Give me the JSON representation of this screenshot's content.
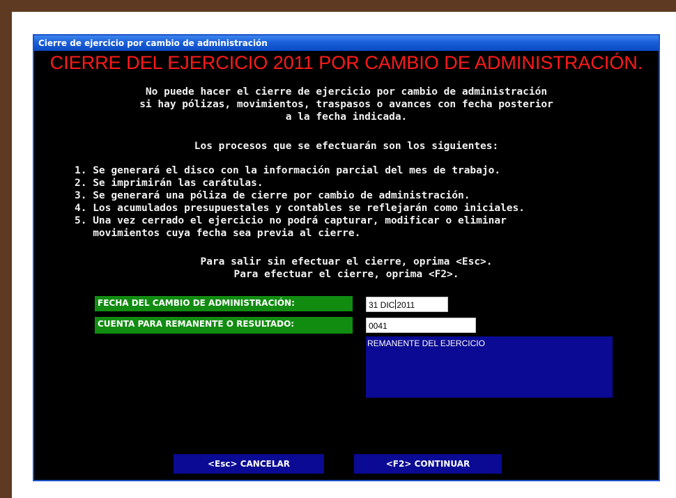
{
  "window": {
    "title": "Cierre de ejercicio por cambio de administración",
    "heading": "CIERRE DEL EJERCICIO 2011 POR CAMBIO DE ADMINISTRACIÓN."
  },
  "notice": {
    "lines": [
      "No puede hacer el cierre de ejercicio por cambio de administración",
      "si hay pólizas, movimientos, traspasos o avances con fecha posterior",
      "a la fecha indicada."
    ]
  },
  "processes": {
    "intro": "Los procesos que se efectuarán son los siguientes:",
    "items": [
      "1. Se generará el disco con la información parcial del mes de trabajo.",
      "2. Se imprimirán las carátulas.",
      "3. Se generará una póliza de cierre por cambio de administración.",
      "4. Los acumulados presupuestales y contables se reflejarán como iniciales.",
      "5. Una vez cerrado el ejercicio no podrá capturar, modificar o eliminar",
      "   movimientos cuya fecha sea previa al cierre."
    ]
  },
  "instructions": {
    "exit": "Para salir sin efectuar el cierre, oprima <Esc>.",
    "continue": "Para efectuar el cierre, oprima <F2>."
  },
  "form": {
    "date_label": "FECHA DEL CAMBIO DE ADMINISTRACIÓN:",
    "date_value_part1": "31 DIC",
    "date_value_part2": "2011",
    "account_label": "CUENTA PARA REMANENTE O RESULTADO:",
    "account_value": "0041",
    "account_description": "REMANENTE DEL EJERCICIO"
  },
  "buttons": {
    "cancel": "<Esc>  CANCELAR",
    "continue": "<F2>  CONTINUAR"
  },
  "colors": {
    "frame": "#5e3a22",
    "heading": "#ff1a1a",
    "label_bg": "#118c11",
    "button_bg": "#0a0a94",
    "titlebar": "#1a5fd8"
  }
}
